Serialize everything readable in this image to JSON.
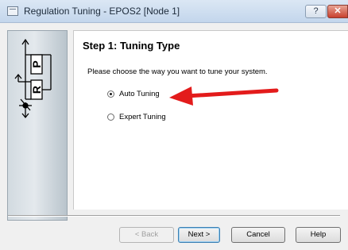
{
  "window": {
    "title": "Regulation Tuning - EPOS2 [Node 1]",
    "help_button": "?",
    "close_button": "✕"
  },
  "side_image": {
    "icon": "controller-diagram-icon",
    "block_labels": [
      "P",
      "R"
    ]
  },
  "step": {
    "title": "Step 1: Tuning Type",
    "instruction": "Please choose the way you want to tune your system."
  },
  "options": [
    {
      "label": "Auto Tuning",
      "selected": true
    },
    {
      "label": "Expert Tuning",
      "selected": false
    }
  ],
  "annotation": {
    "color": "#e31b1b"
  },
  "buttons": {
    "back": "< Back",
    "next": "Next >",
    "cancel": "Cancel",
    "help": "Help"
  }
}
